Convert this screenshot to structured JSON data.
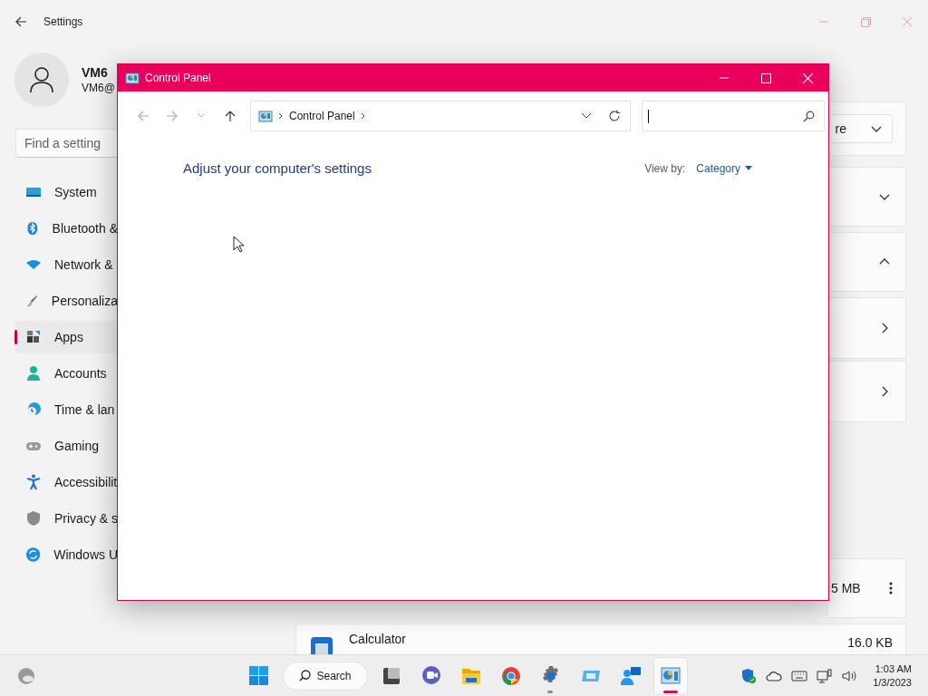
{
  "settings": {
    "title": "Settings",
    "user": {
      "name": "VM6",
      "email": "VM6@"
    },
    "search": {
      "placeholder": "Find a setting"
    },
    "nav_items": [
      {
        "label": "System",
        "selected": false
      },
      {
        "label": "Bluetooth &",
        "selected": false
      },
      {
        "label": "Network &",
        "selected": false
      },
      {
        "label": "Personaliza",
        "selected": false
      },
      {
        "label": "Apps",
        "selected": true
      },
      {
        "label": "Accounts",
        "selected": false
      },
      {
        "label": "Time & lan",
        "selected": false
      },
      {
        "label": "Gaming",
        "selected": false
      },
      {
        "label": "Accessibilit",
        "selected": false
      },
      {
        "label": "Privacy & s",
        "selected": false
      },
      {
        "label": "Windows U",
        "selected": false
      }
    ],
    "cards": [
      {
        "kind": "dropdown",
        "value": "re"
      },
      {
        "kind": "expander",
        "expanded": false
      },
      {
        "kind": "expander",
        "expanded": true
      },
      {
        "kind": "link"
      },
      {
        "kind": "link"
      }
    ],
    "apps": [
      {
        "size": "5 MB"
      },
      {
        "name": "Calculator",
        "size": "16.0 KB"
      }
    ]
  },
  "control_panel": {
    "title": "Control Panel",
    "address": "Control Panel",
    "heading": "Adjust your computer's settings",
    "view_by_label": "View by:",
    "view_by_value": "Category"
  },
  "taskbar": {
    "search": "Search",
    "apps": [
      {
        "running": false,
        "active": false
      },
      {
        "running": false,
        "active": false
      },
      {
        "running": false,
        "active": false
      },
      {
        "running": false,
        "active": false
      },
      {
        "running": true,
        "active": false
      },
      {
        "running": false,
        "active": false
      },
      {
        "running": false,
        "active": false
      },
      {
        "running": true,
        "active": true
      }
    ],
    "time": "1:03 AM",
    "date": "1/3/2023"
  }
}
